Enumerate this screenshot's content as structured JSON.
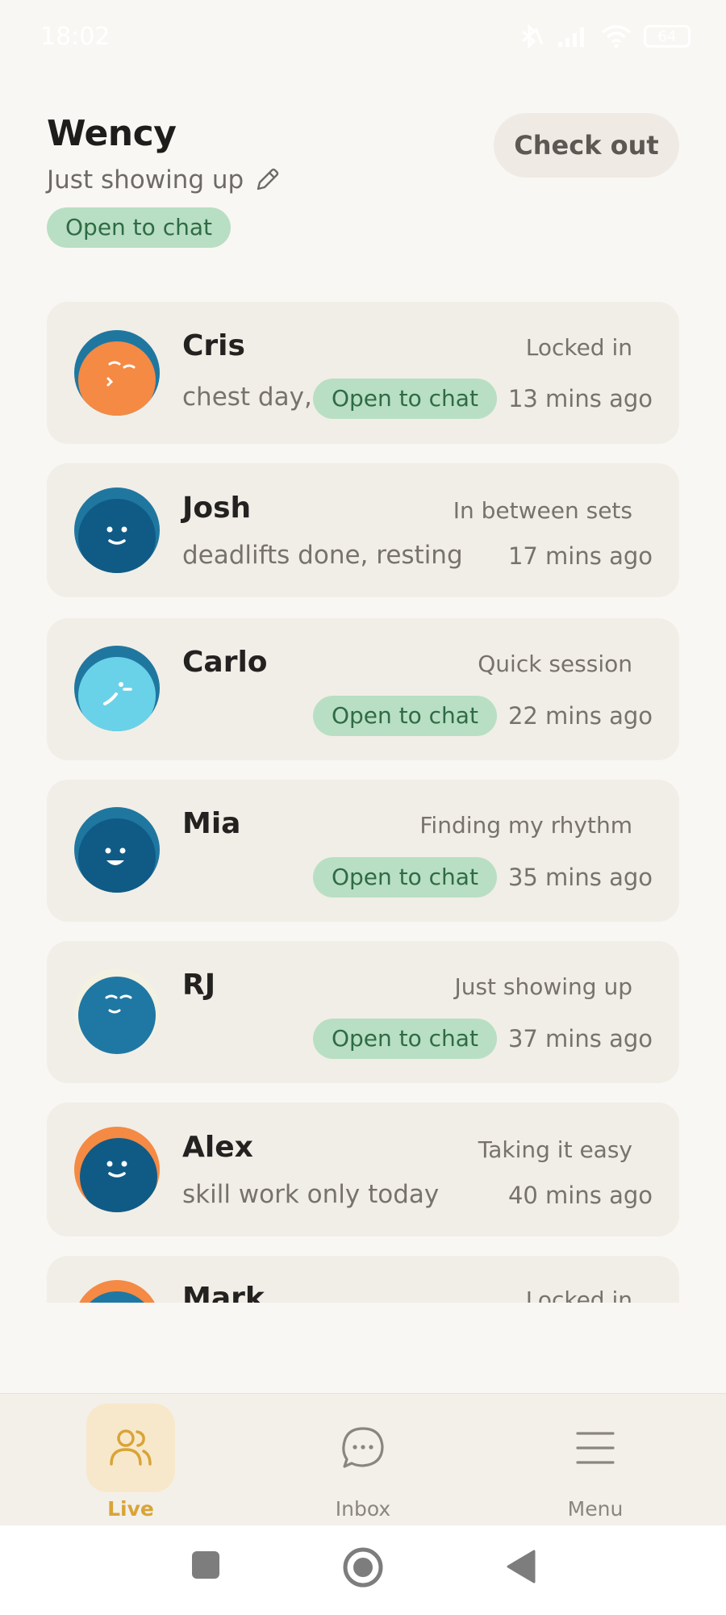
{
  "status_bar": {
    "time": "18:02",
    "battery": "64"
  },
  "user": {
    "name": "Wency",
    "status": "Just showing up",
    "chat_badge": "Open to chat"
  },
  "checkout_label": "Check out",
  "members": [
    {
      "name": "Cris",
      "mood": "Locked in",
      "note": "chest day, …",
      "chat_badge": "Open to chat",
      "time": "13 mins ago"
    },
    {
      "name": "Josh",
      "mood": "In between sets",
      "note": "deadlifts done, resting",
      "chat_badge": "",
      "time": "17 mins ago"
    },
    {
      "name": "Carlo",
      "mood": "Quick session",
      "note": "",
      "chat_badge": "Open to chat",
      "time": "22 mins ago"
    },
    {
      "name": "Mia",
      "mood": "Finding my rhythm",
      "note": "",
      "chat_badge": "Open to chat",
      "time": "35 mins ago"
    },
    {
      "name": "RJ",
      "mood": "Just showing up",
      "note": "",
      "chat_badge": "Open to chat",
      "time": "37 mins ago"
    },
    {
      "name": "Alex",
      "mood": "Taking it easy",
      "note": "skill work only today",
      "chat_badge": "",
      "time": "40 mins ago"
    },
    {
      "name": "Mark",
      "mood": "Locked in",
      "note": "",
      "chat_badge": "",
      "time": ""
    }
  ],
  "nav": {
    "live": "Live",
    "inbox": "Inbox",
    "menu": "Menu"
  },
  "colors": {
    "accent": "#d9a437",
    "chat_pill_bg": "#b8dfc3",
    "chat_pill_text": "#2f6b45",
    "card_bg": "#f1eee7"
  }
}
